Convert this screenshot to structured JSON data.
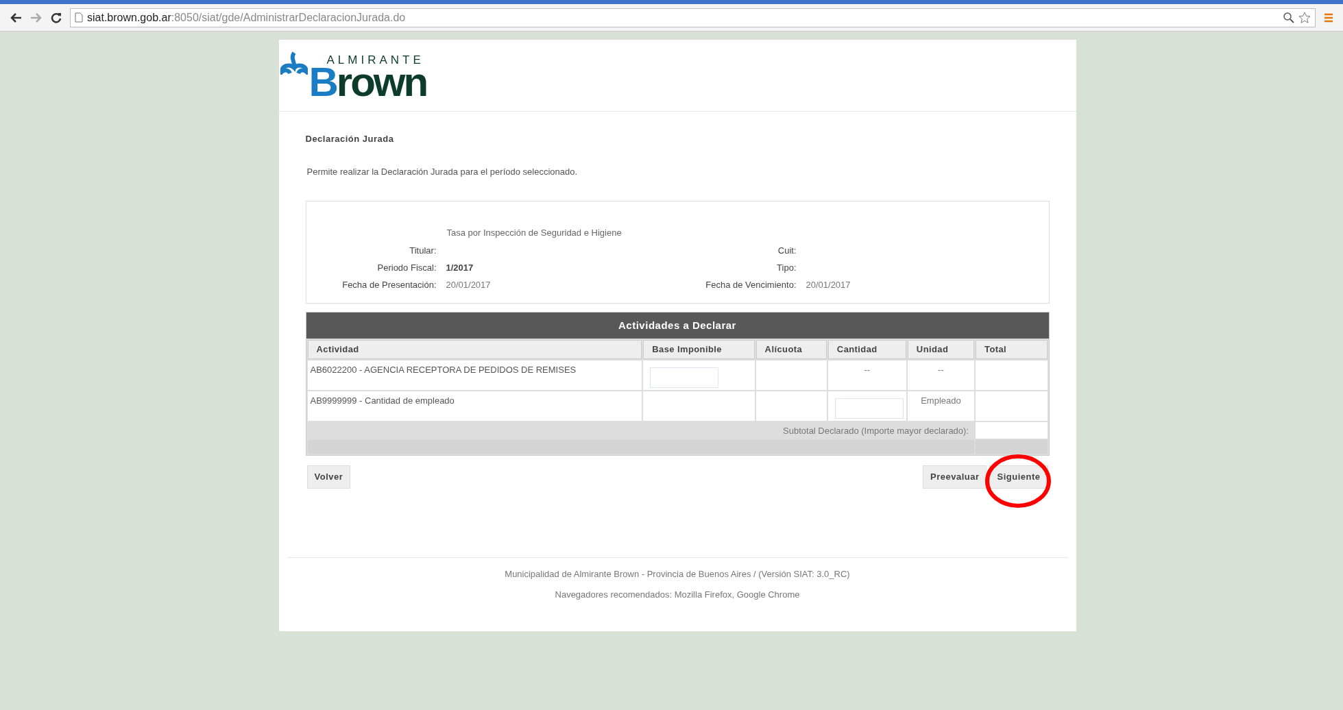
{
  "browser": {
    "url_host": "siat.brown.gob.ar",
    "url_path": ":8050/siat/gde/AdministrarDeclaracionJurada.do"
  },
  "logo": {
    "top": "ALMIRANTE",
    "main": "Brown"
  },
  "heading": "Declaración Jurada",
  "description": "Permite realizar la Declaración Jurada para el período seleccionado.",
  "info": {
    "tax": "Tasa por Inspección de Seguridad e Higiene",
    "rows": [
      {
        "left": {
          "label": "Titular:"
        },
        "right": {
          "label": "Cuit:"
        }
      },
      {
        "left": {
          "label": "Periodo Fiscal:",
          "value": "1/2017",
          "bold": true
        },
        "right": {
          "label": "Tipo:"
        }
      },
      {
        "left": {
          "label": "Fecha de Presentación:",
          "value": "20/01/2017",
          "bold": false
        },
        "right": {
          "label": "Fecha de Vencimiento:",
          "value": "20/01/2017",
          "bold": false
        }
      }
    ]
  },
  "table": {
    "title": "Actividades a Declarar",
    "columns": [
      "Actividad",
      "Base Imponible",
      "Alícuota",
      "Cantidad",
      "Unidad",
      "Total"
    ],
    "rows": [
      {
        "cells": [
          {
            "kind": "text",
            "text": "AB6022200 - AGENCIA RECEPTORA DE PEDIDOS DE REMISES"
          },
          {
            "kind": "input"
          },
          {
            "kind": "blank"
          },
          {
            "kind": "center",
            "text": "--"
          },
          {
            "kind": "center",
            "text": "--"
          },
          {
            "kind": "blank"
          }
        ]
      },
      {
        "cells": [
          {
            "kind": "text",
            "text": "AB9999999 - Cantidad de empleado"
          },
          {
            "kind": "blank"
          },
          {
            "kind": "blank"
          },
          {
            "kind": "input"
          },
          {
            "kind": "center",
            "text": "Empleado"
          },
          {
            "kind": "blank"
          }
        ]
      }
    ],
    "subtotal_label": "Subtotal Declarado (Importe mayor declarado):"
  },
  "buttons_left": [
    {
      "label": "Volver",
      "highlighted": false
    }
  ],
  "buttons_right": [
    {
      "label": "Preevaluar",
      "highlighted": false
    },
    {
      "label": "Siguiente",
      "highlighted": true
    }
  ],
  "footer": [
    "Municipalidad de Almirante Brown - Provincia de Buenos Aires / (Versión SIAT: 3.0_RC)",
    "Navegadores recomendados: Mozilla Firefox, Google Chrome"
  ]
}
